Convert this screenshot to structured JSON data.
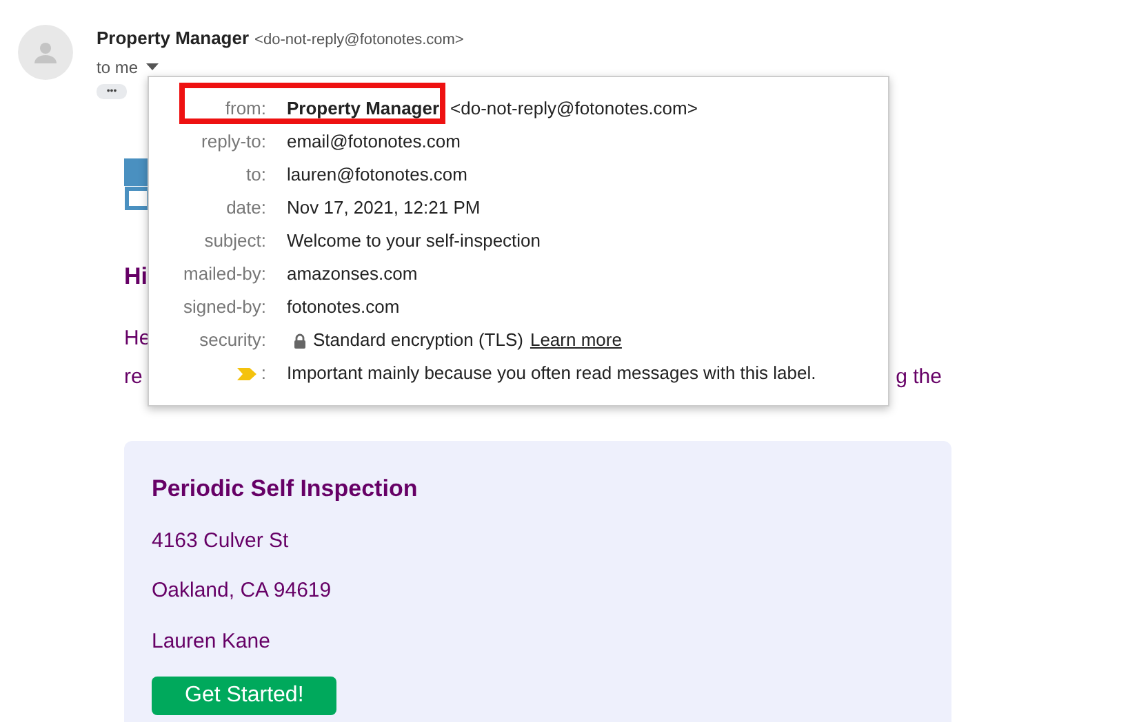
{
  "sender": {
    "name": "Property Manager",
    "address": "<do-not-reply@fotonotes.com>",
    "recipients": "to me"
  },
  "more_button": "•••",
  "details": [
    {
      "kind": "text",
      "label": "from:",
      "value": "Property Manager",
      "extra": "<do-not-reply@fotonotes.com>",
      "highlighted": true
    },
    {
      "kind": "text",
      "label": "reply-to:",
      "value": "email@fotonotes.com",
      "highlighted": false
    },
    {
      "kind": "text",
      "label": "to:",
      "value": "lauren@fotonotes.com",
      "highlighted": false
    },
    {
      "kind": "text",
      "label": "date:",
      "value": "Nov 17, 2021, 12:21 PM",
      "highlighted": false
    },
    {
      "kind": "text",
      "label": "subject:",
      "value": "Welcome to your self-inspection",
      "highlighted": false
    },
    {
      "kind": "text",
      "label": "mailed-by:",
      "value": "amazonses.com",
      "highlighted": false
    },
    {
      "kind": "text",
      "label": "signed-by:",
      "value": "fotonotes.com",
      "highlighted": false
    },
    {
      "kind": "security",
      "label": "security:",
      "value": "Standard encryption (TLS)",
      "link": "Learn more",
      "highlighted": false
    },
    {
      "kind": "importance",
      "label": ":",
      "value": "Important mainly because you often read messages with this label.",
      "highlighted": false
    }
  ],
  "body": {
    "greeting": "Hi",
    "lines": [
      {
        "left": "He"
      },
      {
        "left": "re",
        "right": "g the"
      }
    ]
  },
  "card": {
    "title": "Periodic Self Inspection",
    "lines": [
      "4163 Culver St",
      "Oakland, CA 94619",
      "Lauren Kane"
    ],
    "button": "Get Started!"
  }
}
